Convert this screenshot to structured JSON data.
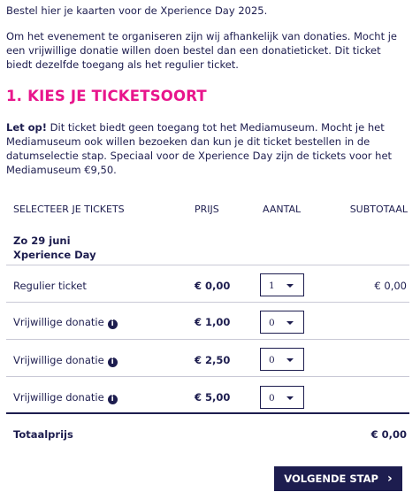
{
  "intro": {
    "line1": "Bestel hier je kaarten voor de Xperience Day 2025.",
    "line2": "Om het evenement te organiseren zijn wij afhankelijk van donaties. Mocht je een vrijwillige donatie willen doen bestel dan een donatieticket. Dit ticket biedt dezelfde toegang als het regulier ticket."
  },
  "section": {
    "title": "1. KIES JE TICKETSOORT",
    "note_bold": "Let op!",
    "note_text": " Dit ticket biedt geen toegang tot het Mediamuseum. Mocht je het Mediamuseum ook willen bezoeken dan kun je dit ticket bestellen in de datumselectie stap. Speciaal voor de Xperience Day zijn de tickets voor het Mediamuseum €9,50."
  },
  "table": {
    "headers": {
      "select": "SELECTEER JE TICKETS",
      "price": "PRIJS",
      "qty": "AANTAL",
      "subtotal": "SUBTOTAAL"
    },
    "group": {
      "date": "Zo 29 juni",
      "event": "Xperience Day"
    },
    "rows": [
      {
        "name": "Regulier ticket",
        "price": "€ 0,00",
        "qty": "1",
        "subtotal": "€ 0,00"
      },
      {
        "name": "Vrijwillige donatie",
        "price": "€ 1,00",
        "qty": "0",
        "subtotal": ""
      },
      {
        "name": "Vrijwillige donatie",
        "price": "€ 2,50",
        "qty": "0",
        "subtotal": ""
      },
      {
        "name": "Vrijwillige donatie",
        "price": "€ 5,00",
        "qty": "0",
        "subtotal": ""
      }
    ],
    "total_label": "Totaalprijs",
    "total_value": "€ 0,00"
  },
  "next_button": "VOLGENDE STAP",
  "colors": {
    "accent": "#e8158c",
    "primary": "#1d1d4f"
  }
}
